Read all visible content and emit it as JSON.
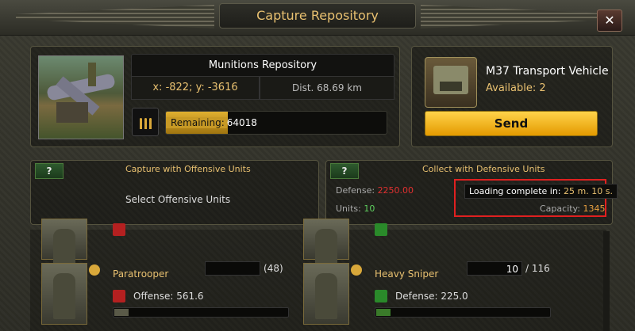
{
  "window": {
    "title": "Capture Repository",
    "close_label": "✕"
  },
  "target": {
    "name": "Munitions Repository",
    "coords": "x: -822; y: -3616",
    "distance": "Dist. 68.69 km",
    "remaining_label": "Remaining:",
    "remaining_value": "64018",
    "remaining_fraction": 0.28
  },
  "vehicle": {
    "name": "M37 Transport Vehicle",
    "available": "Available: 2",
    "send_label": "Send"
  },
  "offensive": {
    "help": "?",
    "title": "Capture with Offensive Units",
    "body": "Select Offensive Units"
  },
  "defensive": {
    "help": "?",
    "title": "Collect with Defensive Units",
    "defense_label": "Defense:",
    "defense_value": "2250.00",
    "units_label": "Units:",
    "units_value": "10",
    "loading_label": "Loading complete in:",
    "loading_value": "25 m. 10 s.",
    "capacity_label": "Capacity:",
    "capacity_value": "1345"
  },
  "units": [
    {
      "name": "Paratrooper",
      "stat_label": "Offense: 561.6",
      "quantity": "",
      "max": "(48)"
    },
    {
      "name": "Heavy Sniper",
      "stat_label": "Defense: 225.0",
      "quantity": "10",
      "max": "/ 116"
    }
  ],
  "colors": {
    "accent": "#e8c070",
    "send": "#f2b01e",
    "highlight": "#e02020",
    "danger": "#e03030",
    "ok": "#5fd05f"
  }
}
